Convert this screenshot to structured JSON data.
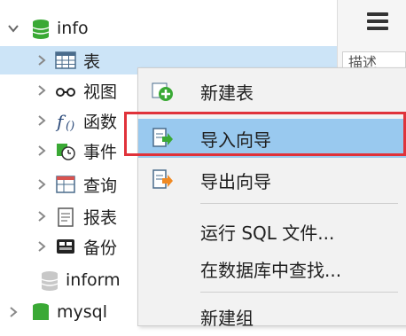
{
  "tree": {
    "db_info_label": "info",
    "items": [
      {
        "label": "表",
        "icon": "table-icon"
      },
      {
        "label": "视图",
        "icon": "view-glasses-icon"
      },
      {
        "label": "函数",
        "icon": "function-icon"
      },
      {
        "label": "事件",
        "icon": "event-clock-icon"
      },
      {
        "label": "查询",
        "icon": "query-icon"
      },
      {
        "label": "报表",
        "icon": "report-icon"
      },
      {
        "label": "备份",
        "icon": "backup-icon"
      }
    ],
    "db_information_label": "inform",
    "db_mysql_label": "mysql"
  },
  "right_panel": {
    "tab_label": "描述"
  },
  "context_menu": {
    "items": [
      {
        "label": "新建表",
        "icon": "plus-green-icon"
      },
      {
        "label": "导入向导",
        "icon": "import-wizard-icon"
      },
      {
        "label": "导出向导",
        "icon": "export-wizard-icon"
      },
      {
        "label": "运行 SQL 文件..."
      },
      {
        "label": "在数据库中查找..."
      },
      {
        "label": "新建组"
      }
    ],
    "highlighted_index": 1
  },
  "colors": {
    "selection": "#cce4f7",
    "menu_highlight": "#99c9ef",
    "annotation_frame": "#e0323a",
    "db_green": "#3aa935"
  }
}
